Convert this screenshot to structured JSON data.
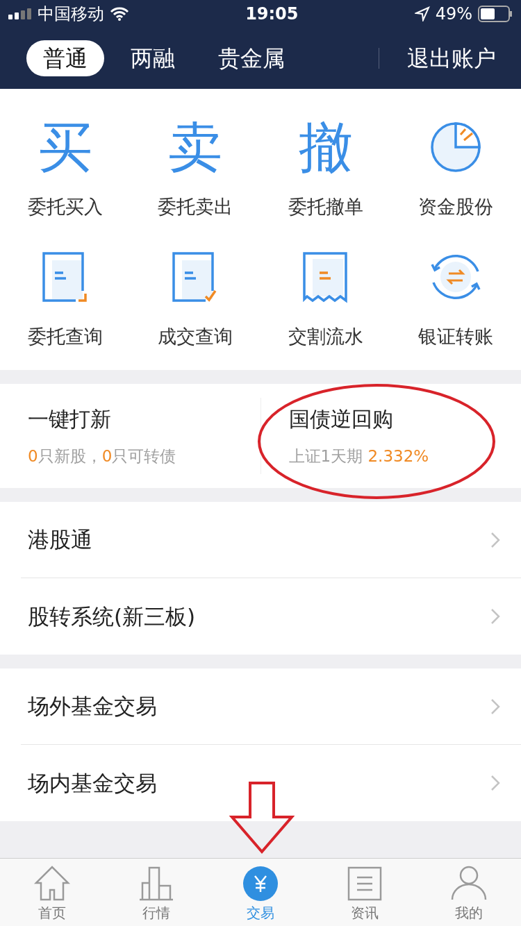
{
  "status_bar": {
    "carrier": "中国移动",
    "time": "19:05",
    "battery": "49%"
  },
  "account_tabs": [
    {
      "label": "普通",
      "selected": true
    },
    {
      "label": "两融",
      "selected": false
    },
    {
      "label": "贵金属",
      "selected": false
    }
  ],
  "logout": "退出账户",
  "actions": [
    {
      "kind": "char",
      "glyph": "买",
      "label": "委托买入"
    },
    {
      "kind": "char",
      "glyph": "卖",
      "label": "委托卖出"
    },
    {
      "kind": "char",
      "glyph": "撤",
      "label": "委托撤单"
    },
    {
      "kind": "pie",
      "label": "资金股份"
    },
    {
      "kind": "doc",
      "label": "委托查询"
    },
    {
      "kind": "doc-check",
      "label": "成交查询"
    },
    {
      "kind": "receipt",
      "label": "交割流水"
    },
    {
      "kind": "exchange",
      "label": "银证转账"
    }
  ],
  "features": [
    {
      "title": "一键打新",
      "subtitle": [
        {
          "text": "0",
          "accent": true
        },
        {
          "text": "只新股，",
          "accent": false
        },
        {
          "text": "0",
          "accent": true
        },
        {
          "text": "只可转债",
          "accent": false
        }
      ]
    },
    {
      "title": "国债逆回购",
      "subtitle": [
        {
          "text": "上证1天期 ",
          "accent": false
        },
        {
          "text": "2.332%",
          "accent": true
        }
      ]
    }
  ],
  "menu_groups": [
    [
      "港股通",
      "股转系统(新三板)"
    ],
    [
      "场外基金交易",
      "场内基金交易"
    ]
  ],
  "bottom_tabs": [
    {
      "label": "首页",
      "selected": false
    },
    {
      "label": "行情",
      "selected": false
    },
    {
      "label": "交易",
      "selected": true
    },
    {
      "label": "资讯",
      "selected": false
    },
    {
      "label": "我的",
      "selected": false
    }
  ]
}
